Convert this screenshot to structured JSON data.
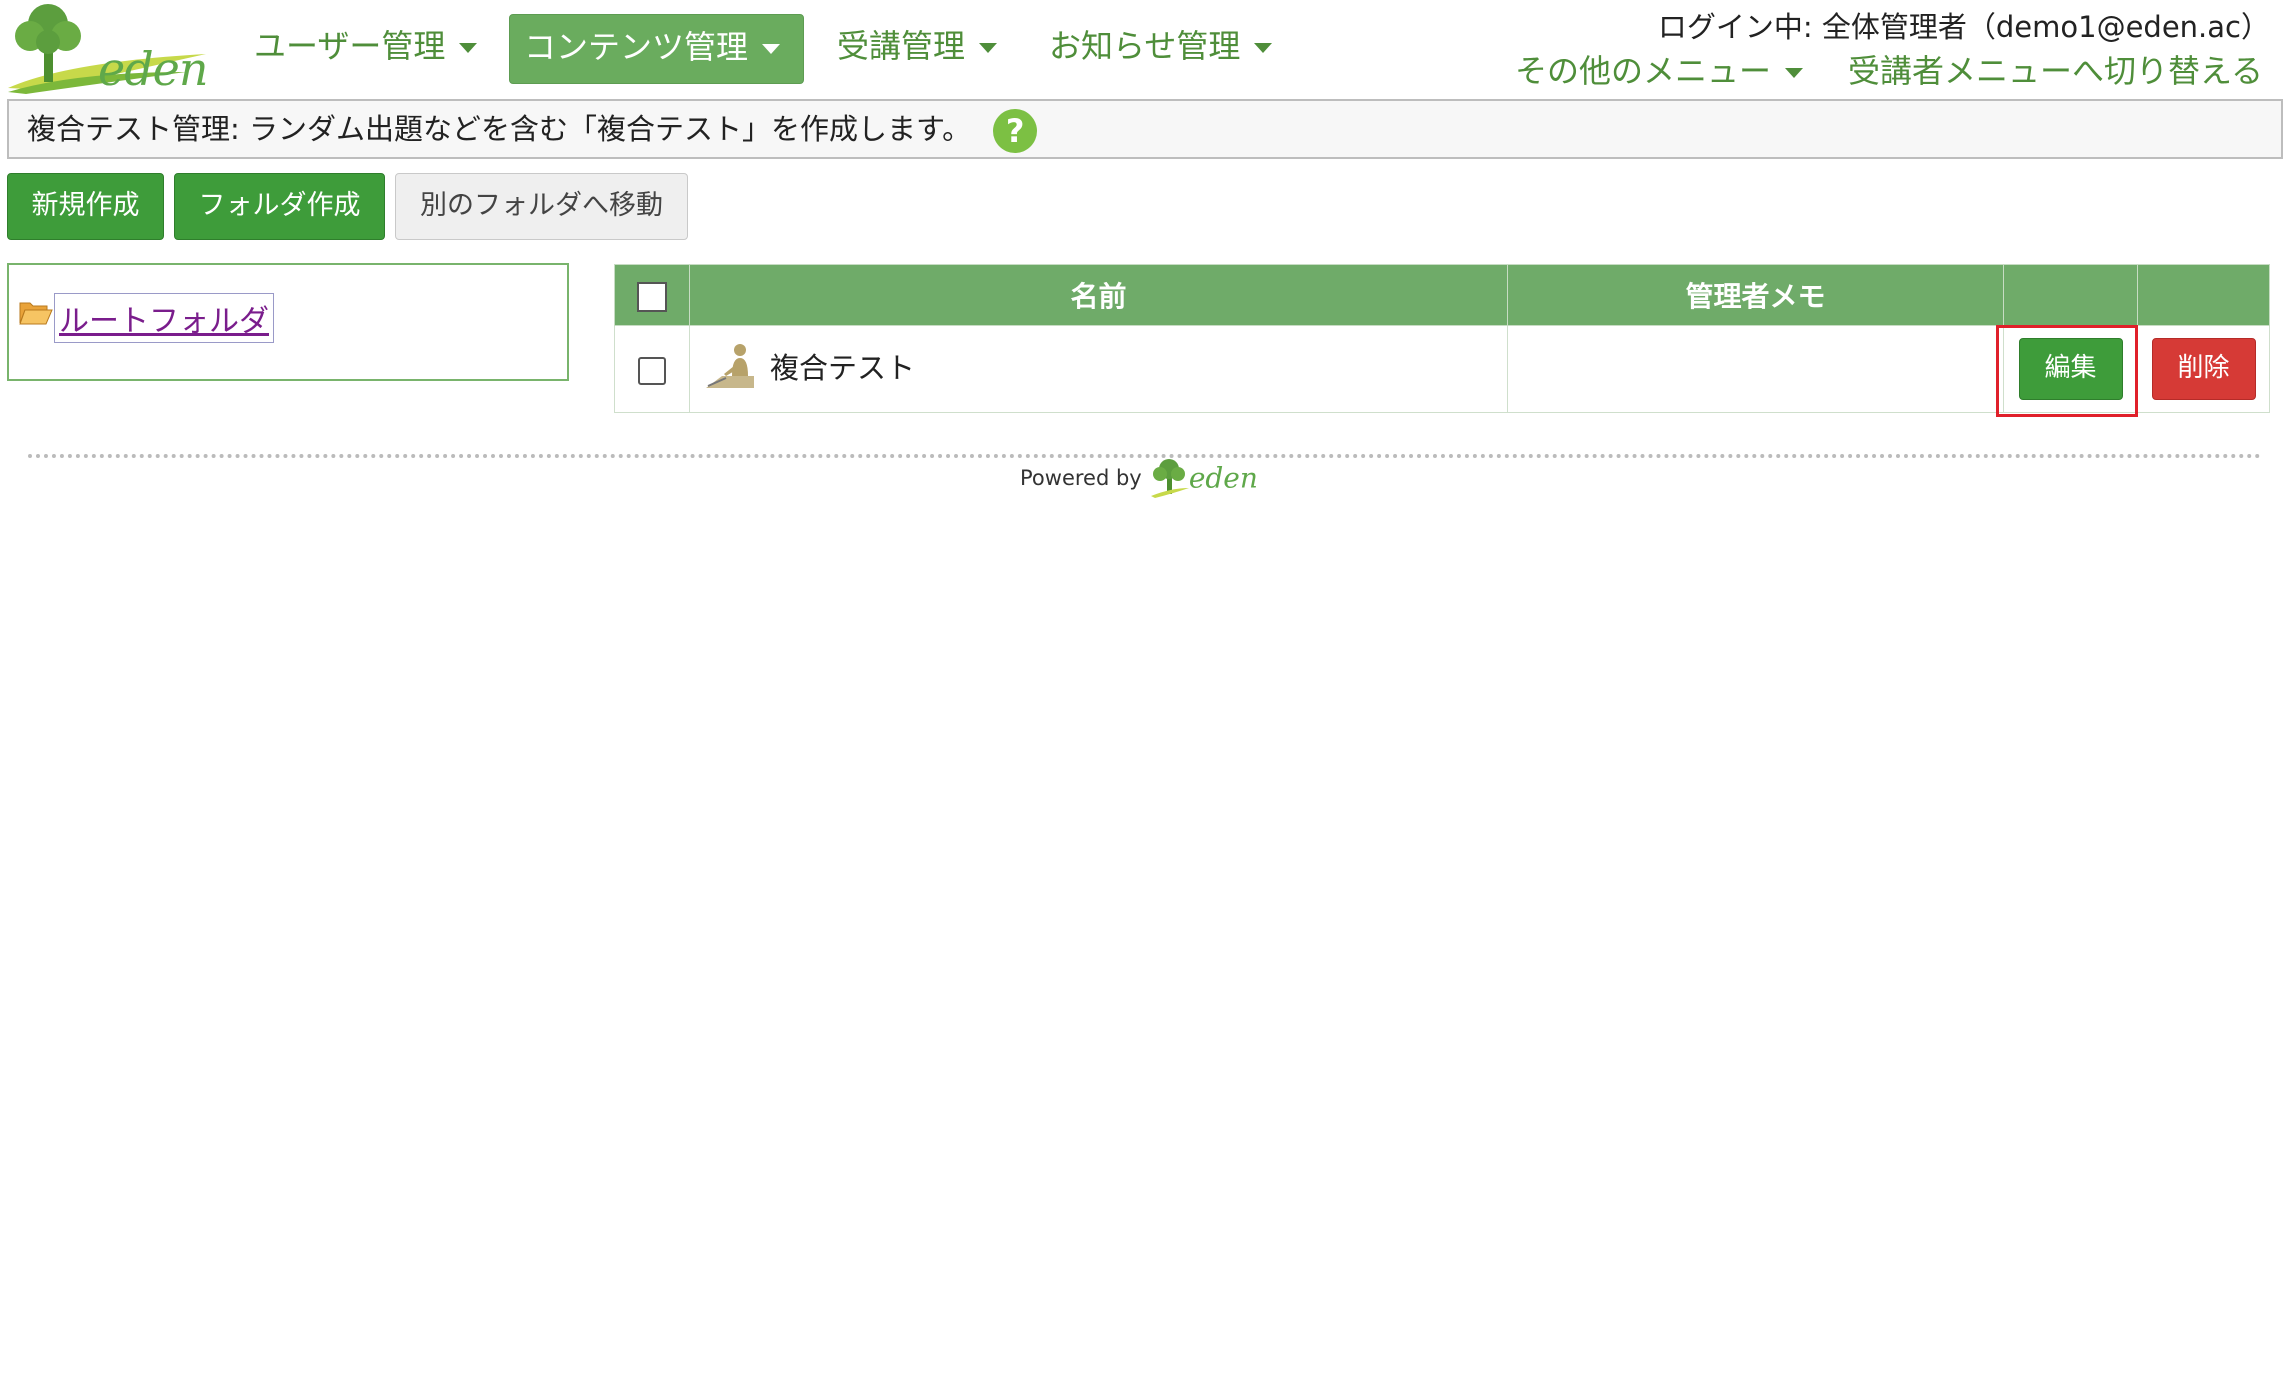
{
  "header": {
    "logo_text": "eden",
    "nav": [
      {
        "label": "ユーザー管理"
      },
      {
        "label": "コンテンツ管理"
      },
      {
        "label": "受講管理"
      },
      {
        "label": "お知らせ管理"
      }
    ],
    "login_status": "ログイン中: 全体管理者（demo1@eden.ac）",
    "other_menu": "その他のメニュー",
    "switch_menu": "受講者メニューへ切り替える"
  },
  "description": {
    "text": "複合テスト管理: ランダム出題などを含む「複合テスト」を作成します。",
    "help_icon": "?"
  },
  "toolbar": {
    "new_label": "新規作成",
    "folder_label": "フォルダ作成",
    "move_label": "別のフォルダへ移動"
  },
  "folder_tree": {
    "root_label": "ルートフォルダ"
  },
  "table": {
    "columns": {
      "name": "名前",
      "memo": "管理者メモ"
    },
    "rows": [
      {
        "name": "複合テスト",
        "memo": "",
        "edit_label": "編集",
        "delete_label": "削除"
      }
    ]
  },
  "footer": {
    "powered_by": "Powered by",
    "brand": "eden"
  },
  "colors": {
    "primary_green": "#3e9c3a",
    "header_green": "#6fab69",
    "nav_text": "#4f8e3a",
    "danger_red": "#d63a36",
    "highlight_red": "#e0202a"
  }
}
